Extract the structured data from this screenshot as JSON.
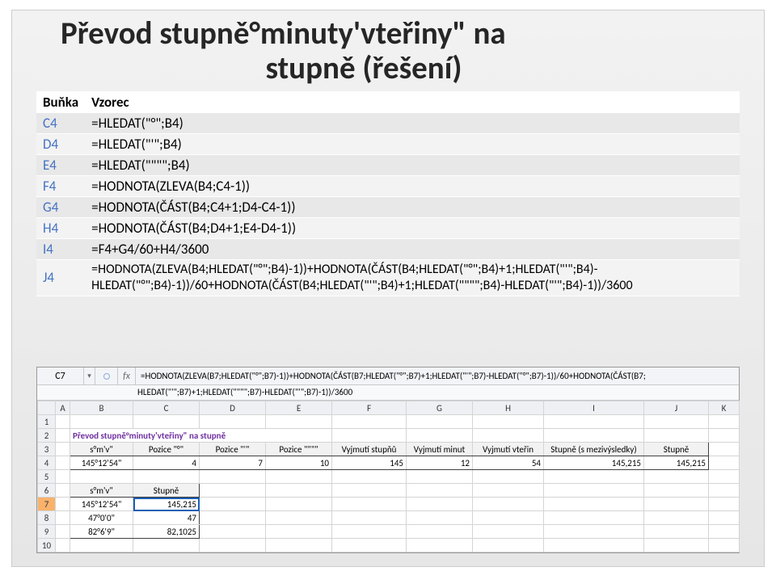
{
  "title_line1": "Převod stupně°minuty'vteřiny\" na",
  "title_line2": "stupně (řešení)",
  "defs": {
    "head_cell": "Buňka",
    "head_formula": "Vzorec",
    "rows": [
      {
        "cell": "C4",
        "formula": "=HLEDAT(\"°\";B4)"
      },
      {
        "cell": "D4",
        "formula": "=HLEDAT(\"'\";B4)"
      },
      {
        "cell": "E4",
        "formula": "=HLEDAT(\"\"\"\";B4)"
      },
      {
        "cell": "F4",
        "formula": "=HODNOTA(ZLEVA(B4;C4-1))"
      },
      {
        "cell": "G4",
        "formula": "=HODNOTA(ČÁST(B4;C4+1;D4-C4-1))"
      },
      {
        "cell": "H4",
        "formula": "=HODNOTA(ČÁST(B4;D4+1;E4-D4-1))"
      },
      {
        "cell": "I4",
        "formula": "=F4+G4/60+H4/3600"
      },
      {
        "cell": "J4",
        "formula": "=HODNOTA(ZLEVA(B4;HLEDAT(\"°\";B4)-1))+HODNOTA(ČÁST(B4;HLEDAT(\"°\";B4)+1;HLEDAT(\"'\";B4)-HLEDAT(\"°\";B4)-1))/60+HODNOTA(ČÁST(B4;HLEDAT(\"'\";B4)+1;HLEDAT(\"\"\"\";B4)-HLEDAT(\"'\";B4)-1))/3600"
      }
    ]
  },
  "ss": {
    "cellref": "C7",
    "fbar1": "=HODNOTA(ZLEVA(B7;HLEDAT(\"°\";B7)-1))+HODNOTA(ČÁST(B7;HLEDAT(\"°\";B7)+1;HLEDAT(\"'\";B7)-HLEDAT(\"°\";B7)-1))/60+HODNOTA(ČÁST(B7;",
    "fbar2": "HLEDAT(\"'\";B7)+1;HLEDAT(\"\"\"\";B7)-HLEDAT(\"'\";B7)-1))/3600",
    "cols": [
      "A",
      "B",
      "C",
      "D",
      "E",
      "F",
      "G",
      "H",
      "I",
      "J",
      "K"
    ],
    "title_row": "Převod stupně°minuty'vteřiny\"  na stupně",
    "head3": [
      "s°m'v\"",
      "Pozice \"°\"",
      "Pozice \"'\"",
      "Pozice \"\"\"\"",
      "Vyjmutí stupňů",
      "Vyjmutí minut",
      "Vyjmutí vteřin",
      "Stupně (s mezivýsledky)",
      "Stupně"
    ],
    "row4": {
      "B": "145°12'54\"",
      "C": "4",
      "D": "7",
      "E": "10",
      "F": "145",
      "G": "12",
      "H": "54",
      "I": "145,215",
      "J": "145,215"
    },
    "head6": [
      "s°m'v\"",
      "Stupně"
    ],
    "rows_bot": [
      {
        "n": "7",
        "B": "145°12'54\"",
        "C": "145,215"
      },
      {
        "n": "8",
        "B": "47°0'0\"",
        "C": "47"
      },
      {
        "n": "9",
        "B": "82°6'9\"",
        "C": "82,1025"
      }
    ]
  }
}
